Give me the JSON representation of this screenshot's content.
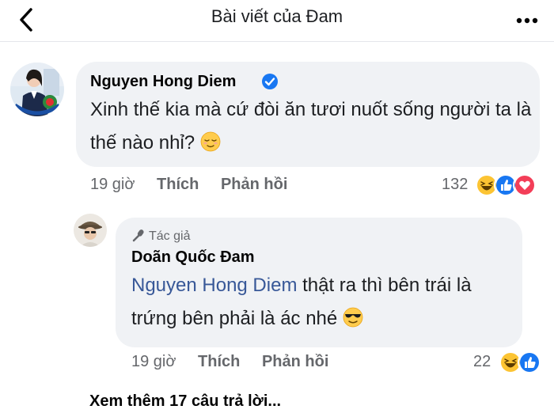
{
  "header": {
    "title": "Bài viết của Đam"
  },
  "comment": {
    "author": "Nguyen Hong Diem",
    "text": "Xinh thế kia mà cứ đòi ăn tươi nuốt sống người ta là thế nào nhỉ?",
    "emoji": "relieved-face",
    "time": "19 giờ",
    "like_label": "Thích",
    "reply_label": "Phản hồi",
    "reaction_count": "132",
    "reactions": [
      "haha",
      "like",
      "love"
    ]
  },
  "reply": {
    "badge": "Tác giả",
    "author": "Doãn Quốc Đam",
    "mention": "Nguyen Hong Diem",
    "text": " thật ra thì bên trái là trứng bên phải là ác nhé",
    "emoji": "sunglasses-face",
    "time": "19 giờ",
    "like_label": "Thích",
    "reply_label": "Phản hồi",
    "reaction_count": "22",
    "reactions": [
      "haha",
      "like"
    ]
  },
  "more_replies": "Xem thêm 17 câu trả lời...",
  "colors": {
    "bubble": "#f0f2f5",
    "link_blue": "#385898",
    "fb_blue": "#1877f2",
    "muted": "#65676b"
  }
}
